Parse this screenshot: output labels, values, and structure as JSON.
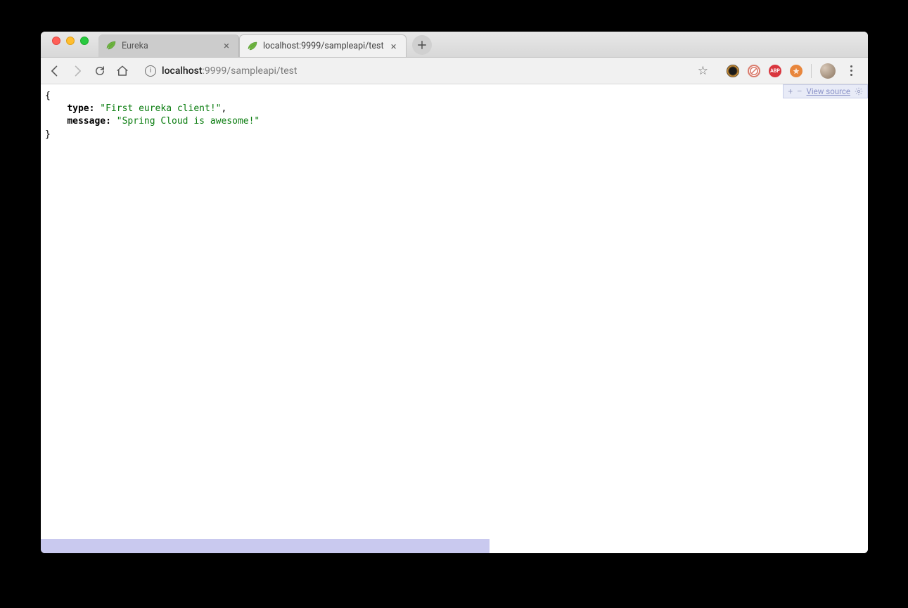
{
  "tabs": [
    {
      "title": "Eureka",
      "active": false,
      "favicon": "spring"
    },
    {
      "title": "localhost:9999/sampleapi/test",
      "active": true,
      "favicon": "spring"
    }
  ],
  "toolbar": {
    "url_host": "localhost",
    "url_port_path": ":9999/sampleapi/test"
  },
  "json_viewer": {
    "expand_label": "+",
    "collapse_label": "–",
    "view_source_label": "View source"
  },
  "json_response": {
    "open_brace": "{",
    "close_brace": "}",
    "entries": [
      {
        "key": "type:",
        "value": "\"First eureka client!\"",
        "trailing": ","
      },
      {
        "key": "message:",
        "value": "\"Spring Cloud is awesome!\"",
        "trailing": ""
      }
    ]
  },
  "extensions": {
    "abp_label": "ABP"
  }
}
